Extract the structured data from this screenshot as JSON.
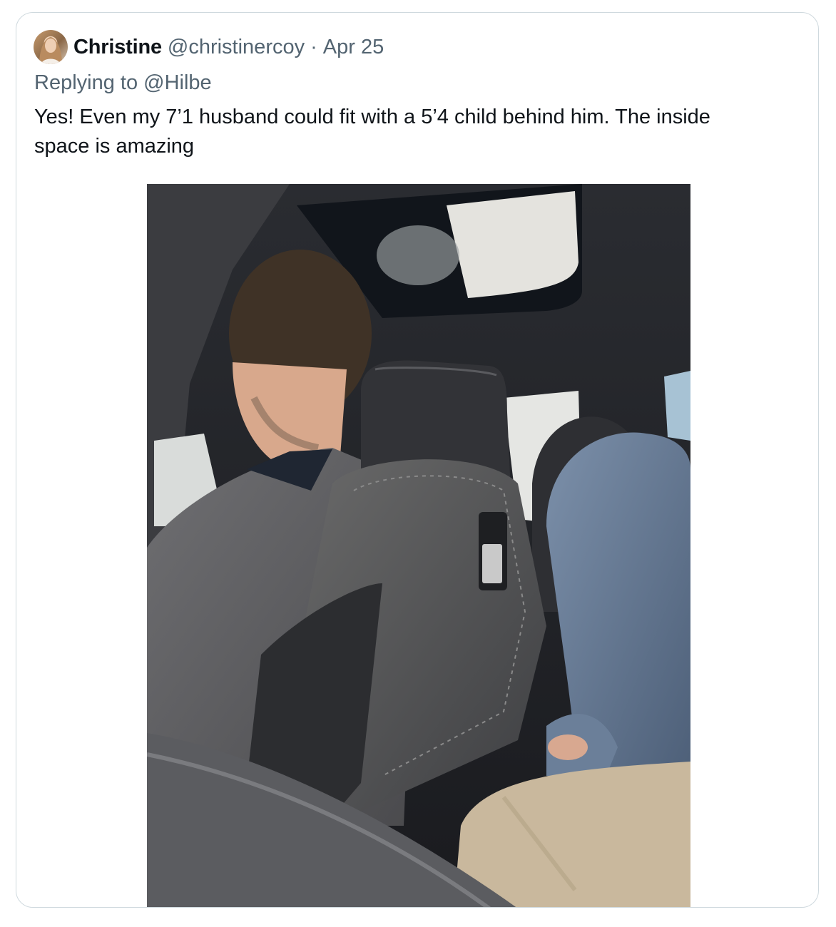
{
  "tweet": {
    "author_name": "Christine",
    "author_handle": "@christinercoy",
    "separator": "·",
    "date": "Apr 25",
    "replying_to": "Replying to @Hilbe",
    "text": "Yes! Even my 7’1 husband could fit with a 5’4 child behind him. The inside space is amazing"
  },
  "media": {
    "kind": "photo",
    "subject": "car-interior-photo"
  },
  "colors": {
    "text_primary": "#0f1419",
    "text_secondary": "#536471",
    "card_border": "#cfd9de"
  }
}
